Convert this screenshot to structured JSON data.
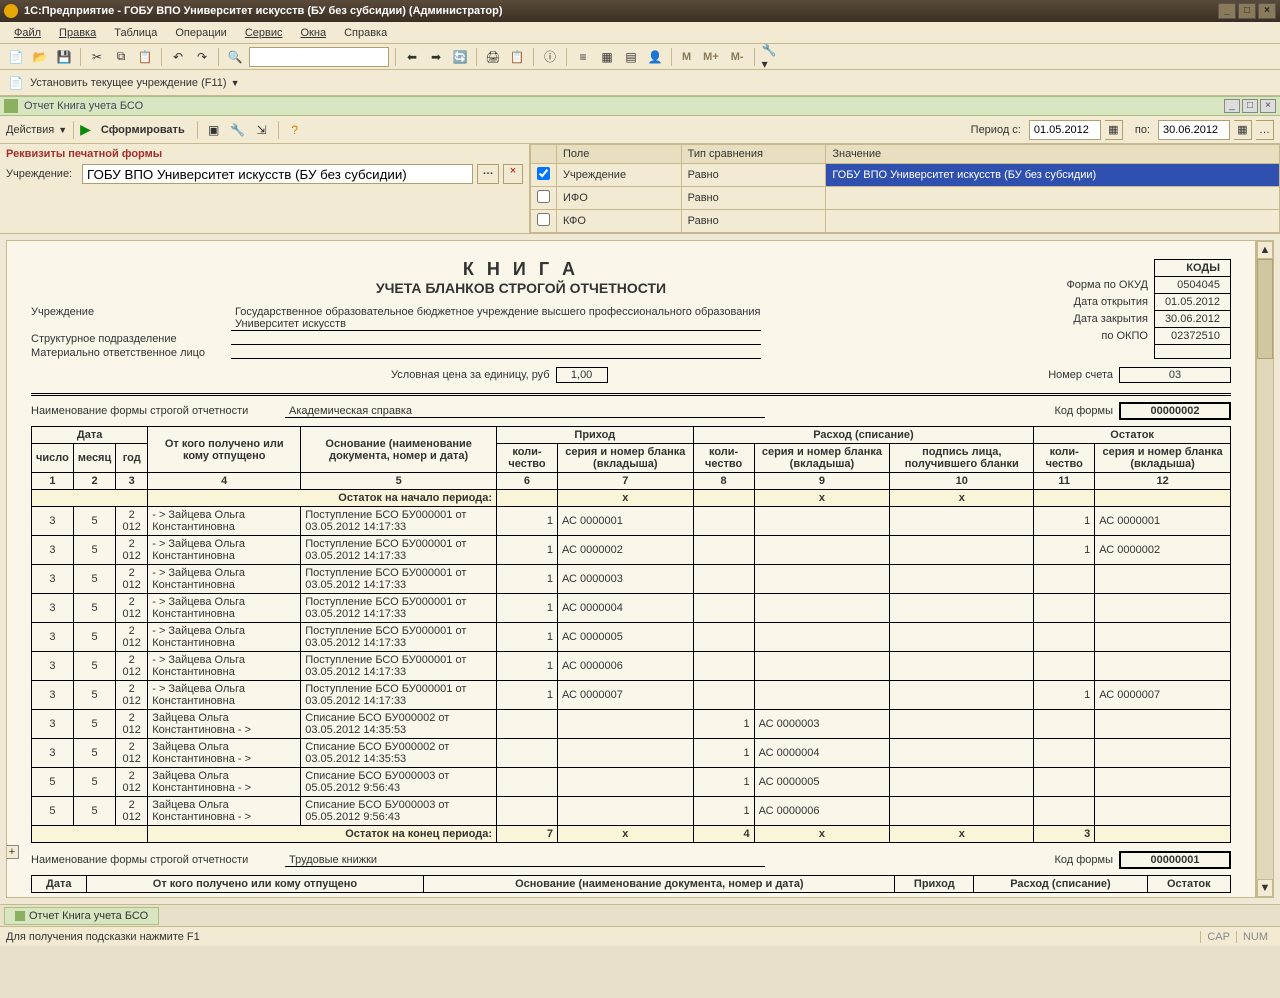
{
  "titlebar": {
    "text": "1С:Предприятие - ГОБУ ВПО Университет искусств (БУ без субсидии) (Администратор)"
  },
  "menu": [
    "Файл",
    "Правка",
    "Таблица",
    "Операции",
    "Сервис",
    "Окна",
    "Справка"
  ],
  "secondbar": {
    "set_inst": "Установить текущее учреждение (F11)"
  },
  "mtext": {
    "m": "М",
    "mplus": "М+",
    "mminus": "М-"
  },
  "inner": {
    "title": "Отчет  Книга учета БСО"
  },
  "rptbar": {
    "actions": "Действия",
    "form": "Сформировать",
    "period_from_lbl": "Период с:",
    "period_from": "01.05.2012",
    "to_lbl": "по:",
    "period_to": "30.06.2012"
  },
  "params": {
    "header": "Реквизиты печатной формы",
    "inst_lbl": "Учреждение:",
    "inst_val": "ГОБУ ВПО Университет искусств (БУ без субсидии)"
  },
  "filter": {
    "h_field": "Поле",
    "h_cmp": "Тип сравнения",
    "h_val": "Значение",
    "rows": [
      {
        "chk": true,
        "field": "Учреждение",
        "cmp": "Равно",
        "val": "ГОБУ ВПО Университет искусств (БУ без субсидии)"
      },
      {
        "chk": false,
        "field": "ИФО",
        "cmp": "Равно",
        "val": ""
      },
      {
        "chk": false,
        "field": "КФО",
        "cmp": "Равно",
        "val": ""
      }
    ]
  },
  "report": {
    "title": "К Н И Г А",
    "subtitle": "УЧЕТА БЛАНКОВ СТРОГОЙ ОТЧЕТНОСТИ",
    "codes_hdr": "КОДЫ",
    "okud_lbl": "Форма по ОКУД",
    "okud": "0504045",
    "open_lbl": "Дата открытия",
    "open": "01.05.2012",
    "close_lbl": "Дата закрытия",
    "close": "30.06.2012",
    "okpo_lbl": "по ОКПО",
    "okpo": "02372510",
    "inst_lbl": "Учреждение",
    "inst_val": "Государственное образовательное бюджетное учреждение высшего профессионального образования  Университет искусств",
    "dept_lbl": "Структурное подразделение",
    "dept_val": "",
    "mol_lbl": "Материально ответственное лицо",
    "mol_val": "",
    "price_lbl": "Условная цена за единицу, руб",
    "price": "1,00",
    "acct_lbl": "Номер счета",
    "acct": "03",
    "formname_lbl": "Наименование формы строгой отчетности",
    "formname": "Академическая справка",
    "formcode_lbl": "Код формы",
    "formcode": "00000002",
    "formname2": "Трудовые книжки",
    "formcode2": "00000001",
    "start_period": "Остаток на начало периода:",
    "end_period": "Остаток на конец периода:",
    "end_vals": {
      "prih_qty": "7",
      "rash_qty": "4",
      "ost_qty": "3",
      "x": "x"
    },
    "hdr": {
      "date": "Дата",
      "day": "число",
      "month": "месяц",
      "year": "год",
      "from": "От кого получено или кому отпущено",
      "basis": "Основание (наименование документа, номер и дата)",
      "prihod": "Приход",
      "rashod": "Расход (списание)",
      "ostatok": "Остаток",
      "qty": "коли-чество",
      "series": "серия и номер бланка (вкладыша)",
      "sign": "подпись лица, получившего бланки"
    },
    "cols": [
      "1",
      "2",
      "3",
      "4",
      "5",
      "6",
      "7",
      "8",
      "9",
      "10",
      "11",
      "12"
    ],
    "rows": [
      {
        "d": "3",
        "m": "5",
        "y": "2 012",
        "from": "- > Зайцева Ольга Константиновна",
        "basis": "Поступление БСО БУ000001 от 03.05.2012 14:17:33",
        "pq": "1",
        "ps": "АС",
        "pn": "0000001",
        "rq": "",
        "rs": "",
        "rn": "",
        "sign": "",
        "oq": "1",
        "os": "АС",
        "on": "0000001"
      },
      {
        "d": "3",
        "m": "5",
        "y": "2 012",
        "from": "- > Зайцева Ольга Константиновна",
        "basis": "Поступление БСО БУ000001 от 03.05.2012 14:17:33",
        "pq": "1",
        "ps": "АС",
        "pn": "0000002",
        "rq": "",
        "rs": "",
        "rn": "",
        "sign": "",
        "oq": "1",
        "os": "АС",
        "on": "0000002"
      },
      {
        "d": "3",
        "m": "5",
        "y": "2 012",
        "from": "- > Зайцева Ольга Константиновна",
        "basis": "Поступление БСО БУ000001 от 03.05.2012 14:17:33",
        "pq": "1",
        "ps": "АС",
        "pn": "0000003",
        "rq": "",
        "rs": "",
        "rn": "",
        "sign": "",
        "oq": "",
        "os": "",
        "on": ""
      },
      {
        "d": "3",
        "m": "5",
        "y": "2 012",
        "from": "- > Зайцева Ольга Константиновна",
        "basis": "Поступление БСО БУ000001 от 03.05.2012 14:17:33",
        "pq": "1",
        "ps": "АС",
        "pn": "0000004",
        "rq": "",
        "rs": "",
        "rn": "",
        "sign": "",
        "oq": "",
        "os": "",
        "on": ""
      },
      {
        "d": "3",
        "m": "5",
        "y": "2 012",
        "from": "- > Зайцева Ольга Константиновна",
        "basis": "Поступление БСО БУ000001 от 03.05.2012 14:17:33",
        "pq": "1",
        "ps": "АС",
        "pn": "0000005",
        "rq": "",
        "rs": "",
        "rn": "",
        "sign": "",
        "oq": "",
        "os": "",
        "on": ""
      },
      {
        "d": "3",
        "m": "5",
        "y": "2 012",
        "from": "- > Зайцева Ольга Константиновна",
        "basis": "Поступление БСО БУ000001 от 03.05.2012 14:17:33",
        "pq": "1",
        "ps": "АС",
        "pn": "0000006",
        "rq": "",
        "rs": "",
        "rn": "",
        "sign": "",
        "oq": "",
        "os": "",
        "on": ""
      },
      {
        "d": "3",
        "m": "5",
        "y": "2 012",
        "from": "- > Зайцева Ольга Константиновна",
        "basis": "Поступление БСО БУ000001 от 03.05.2012 14:17:33",
        "pq": "1",
        "ps": "АС",
        "pn": "0000007",
        "rq": "",
        "rs": "",
        "rn": "",
        "sign": "",
        "oq": "1",
        "os": "АС",
        "on": "0000007"
      },
      {
        "d": "3",
        "m": "5",
        "y": "2 012",
        "from": "Зайцева Ольга Константиновна - >",
        "basis": "Списание БСО БУ000002 от 03.05.2012 14:35:53",
        "pq": "",
        "ps": "",
        "pn": "",
        "rq": "1",
        "rs": "АС",
        "rn": "0000003",
        "sign": "",
        "oq": "",
        "os": "",
        "on": ""
      },
      {
        "d": "3",
        "m": "5",
        "y": "2 012",
        "from": "Зайцева Ольга Константиновна - >",
        "basis": "Списание БСО БУ000002 от 03.05.2012 14:35:53",
        "pq": "",
        "ps": "",
        "pn": "",
        "rq": "1",
        "rs": "АС",
        "rn": "0000004",
        "sign": "",
        "oq": "",
        "os": "",
        "on": ""
      },
      {
        "d": "5",
        "m": "5",
        "y": "2 012",
        "from": "Зайцева Ольга Константиновна - >",
        "basis": "Списание БСО БУ000003 от 05.05.2012 9:56:43",
        "pq": "",
        "ps": "",
        "pn": "",
        "rq": "1",
        "rs": "АС",
        "rn": "0000005",
        "sign": "",
        "oq": "",
        "os": "",
        "on": ""
      },
      {
        "d": "5",
        "m": "5",
        "y": "2 012",
        "from": "Зайцева Ольга Константиновна - >",
        "basis": "Списание БСО БУ000003 от 05.05.2012 9:56:43",
        "pq": "",
        "ps": "",
        "pn": "",
        "rq": "1",
        "rs": "АС",
        "rn": "0000006",
        "sign": "",
        "oq": "",
        "os": "",
        "on": ""
      }
    ]
  },
  "tab": {
    "label": "Отчет  Книга учета БСО"
  },
  "status": {
    "hint": "Для получения подсказки нажмите F1",
    "cap": "CAP",
    "num": "NUM"
  }
}
